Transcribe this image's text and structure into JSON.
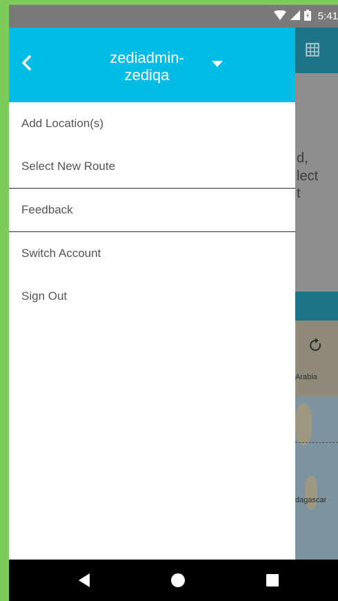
{
  "status_bar": {
    "time": "5:41",
    "icons": [
      "wifi-icon",
      "signal-icon",
      "battery-icon"
    ]
  },
  "drawer": {
    "account_name": "zediadmin-zediqa",
    "header_color": "#04bde6",
    "menu_items": [
      {
        "label": "Add Location(s)"
      },
      {
        "label": "Select New Route"
      },
      {
        "label": "Feedback"
      },
      {
        "label": "Switch Account"
      },
      {
        "label": "Sign Out"
      }
    ]
  },
  "background": {
    "text_lines": [
      "d,",
      "lect",
      "t"
    ],
    "map_labels": [
      "Arabia",
      "dagascar"
    ]
  },
  "nav_bar": {
    "buttons": [
      "back-icon",
      "home-icon",
      "recents-icon"
    ]
  }
}
